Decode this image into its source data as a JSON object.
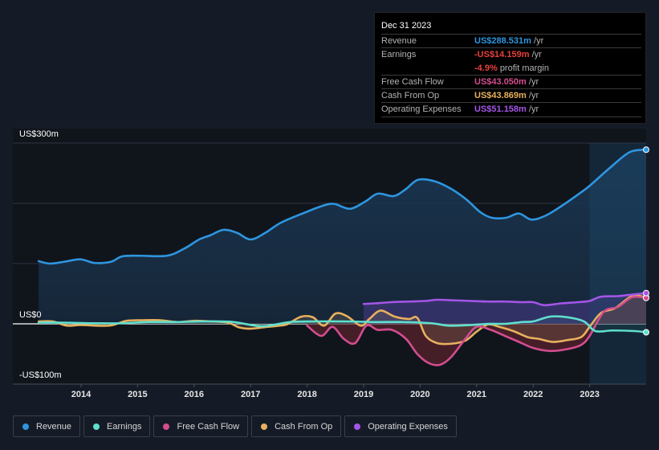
{
  "tooltip": {
    "date": "Dec 31 2023",
    "rows": [
      {
        "label": "Revenue",
        "value": "US$288.531m",
        "unit": "/yr",
        "color": "#2e96e0"
      },
      {
        "label": "Earnings",
        "value": "-US$14.159m",
        "unit": "/yr",
        "color": "#e8413c"
      },
      {
        "label": "Free Cash Flow",
        "value": "US$43.050m",
        "unit": "/yr",
        "color": "#d34d8f"
      },
      {
        "label": "Cash From Op",
        "value": "US$43.869m",
        "unit": "/yr",
        "color": "#e8b05e"
      },
      {
        "label": "Operating Expenses",
        "value": "US$51.158m",
        "unit": "/yr",
        "color": "#a455e8"
      }
    ],
    "profit_margin_value": "-4.9%",
    "profit_margin_label": "profit margin"
  },
  "legend": [
    {
      "label": "Revenue",
      "color": "#2e96e0"
    },
    {
      "label": "Earnings",
      "color": "#5fe0cf"
    },
    {
      "label": "Free Cash Flow",
      "color": "#d34d8f"
    },
    {
      "label": "Cash From Op",
      "color": "#e8b05e"
    },
    {
      "label": "Operating Expenses",
      "color": "#a455e8"
    }
  ],
  "chart_data": {
    "type": "area",
    "title": "",
    "xlabel": "",
    "ylabel": "",
    "ylim": [
      -100,
      300
    ],
    "xlim": [
      2013.0,
      2024.0
    ],
    "y_ticks": [
      {
        "value": 300,
        "label": "US$300m"
      },
      {
        "value": 0,
        "label": "US$0"
      },
      {
        "value": -100,
        "label": "-US$100m"
      }
    ],
    "x_ticks": [
      2014,
      2015,
      2016,
      2017,
      2018,
      2019,
      2020,
      2021,
      2022,
      2023
    ],
    "gridlines": [
      300,
      200,
      100,
      0,
      -100
    ],
    "highlight_from": 2023.0,
    "series": [
      {
        "name": "Revenue",
        "color": "#2e96e0",
        "x": [
          2013.25,
          2013.45,
          2013.7,
          2013.99,
          2014.24,
          2014.53,
          2014.73,
          2015.05,
          2015.52,
          2015.83,
          2016.09,
          2016.29,
          2016.52,
          2016.76,
          2017.0,
          2017.26,
          2017.54,
          2017.97,
          2018.28,
          2018.48,
          2018.76,
          2019.03,
          2019.25,
          2019.53,
          2019.74,
          2019.96,
          2020.24,
          2020.53,
          2020.81,
          2021.07,
          2021.27,
          2021.52,
          2021.75,
          2021.97,
          2022.23,
          2022.51,
          2022.8,
          2023.0,
          2023.36,
          2023.71,
          2024.0
        ],
        "values": [
          104,
          100,
          103,
          107,
          101,
          103,
          112,
          113,
          113,
          125,
          140,
          147,
          156,
          151,
          140,
          151,
          168,
          185,
          196,
          199,
          191,
          203,
          216,
          212,
          223,
          239,
          237,
          225,
          207,
          185,
          176,
          176,
          183,
          173,
          180,
          196,
          215,
          229,
          259,
          285,
          289
        ]
      },
      {
        "name": "Earnings",
        "color": "#5fe0cf",
        "x": [
          2013.25,
          2013.7,
          2014.2,
          2014.7,
          2015.2,
          2015.7,
          2016.2,
          2016.7,
          2017.2,
          2017.7,
          2018.2,
          2018.7,
          2019.2,
          2019.7,
          2020.2,
          2020.5,
          2020.9,
          2021.2,
          2021.5,
          2021.8,
          2022.0,
          2022.3,
          2022.6,
          2022.9,
          2023.1,
          2023.4,
          2023.8,
          2024.0
        ],
        "values": [
          2,
          2,
          1,
          1,
          3,
          3,
          4,
          3,
          -4,
          3,
          4,
          4,
          3,
          3,
          1,
          -3,
          -2,
          0,
          0,
          3,
          4,
          12,
          11,
          4,
          -12,
          -11,
          -12,
          -14
        ]
      },
      {
        "name": "Free Cash Flow",
        "color": "#d34d8f",
        "x": [
          2018.0,
          2018.25,
          2018.45,
          2018.65,
          2018.85,
          2019.05,
          2019.25,
          2019.5,
          2019.75,
          2019.95,
          2020.15,
          2020.35,
          2020.55,
          2020.8,
          2021.0,
          2021.25,
          2021.5,
          2021.75,
          2022.0,
          2022.3,
          2022.6,
          2022.85,
          2023.0,
          2023.25,
          2023.5,
          2023.75,
          2024.0
        ],
        "values": [
          -3,
          -20,
          -5,
          -25,
          -32,
          -3,
          -10,
          -10,
          -25,
          -50,
          -65,
          -68,
          -55,
          -25,
          -5,
          -10,
          -20,
          -30,
          -40,
          -45,
          -42,
          -35,
          -20,
          20,
          28,
          44,
          43
        ]
      },
      {
        "name": "Cash From Op",
        "color": "#e8b05e",
        "x": [
          2013.25,
          2013.5,
          2013.75,
          2014.0,
          2014.5,
          2014.8,
          2015.1,
          2015.4,
          2015.7,
          2016.0,
          2016.3,
          2016.6,
          2016.8,
          2017.0,
          2017.3,
          2017.6,
          2017.7,
          2017.9,
          2018.1,
          2018.3,
          2018.5,
          2018.7,
          2018.95,
          2019.1,
          2019.3,
          2019.55,
          2019.8,
          2019.95,
          2020.1,
          2020.3,
          2020.55,
          2020.8,
          2021.0,
          2021.2,
          2021.4,
          2021.65,
          2021.9,
          2022.1,
          2022.35,
          2022.6,
          2022.85,
          2023.0,
          2023.2,
          2023.45,
          2023.75,
          2024.0
        ],
        "values": [
          4,
          4,
          -3,
          -2,
          -3,
          5,
          6,
          6,
          3,
          5,
          4,
          2,
          -6,
          -8,
          -5,
          -2,
          2,
          12,
          11,
          -3,
          17,
          13,
          -3,
          8,
          22,
          12,
          8,
          10,
          -20,
          -32,
          -33,
          -28,
          -13,
          -1,
          -5,
          -12,
          -22,
          -25,
          -30,
          -27,
          -22,
          -5,
          18,
          26,
          46,
          44
        ]
      },
      {
        "name": "Operating Expenses",
        "color": "#a455e8",
        "x": [
          2019.0,
          2019.2,
          2019.5,
          2019.8,
          2020.1,
          2020.3,
          2020.6,
          2020.9,
          2021.2,
          2021.5,
          2021.8,
          2022.0,
          2022.2,
          2022.5,
          2022.8,
          2023.0,
          2023.2,
          2023.5,
          2023.8,
          2024.0
        ],
        "values": [
          33,
          34,
          36,
          37,
          38,
          40,
          39,
          38,
          37,
          37,
          36,
          36,
          31,
          34,
          36,
          38,
          45,
          46,
          49,
          51
        ]
      }
    ]
  }
}
